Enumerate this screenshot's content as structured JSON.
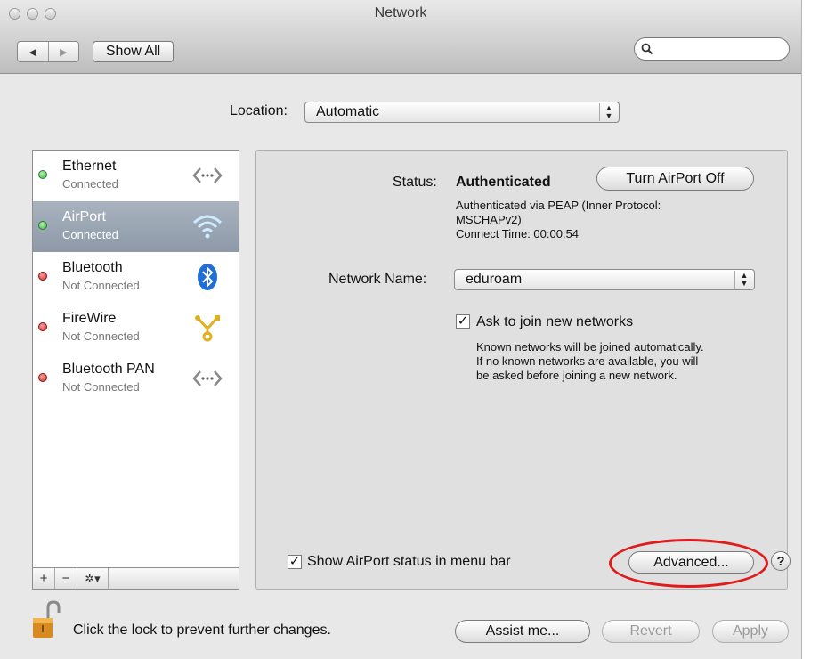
{
  "window": {
    "title": "Network"
  },
  "toolbar": {
    "back_glyph": "◀",
    "forward_glyph": "▶",
    "show_all_label": "Show All",
    "search_placeholder": ""
  },
  "location": {
    "label": "Location:",
    "value": "Automatic"
  },
  "services": [
    {
      "name": "Ethernet",
      "status": "Connected",
      "dot_color": "#3cb043",
      "icon": "ethernet-icon"
    },
    {
      "name": "AirPort",
      "status": "Connected",
      "dot_color": "#3cb043",
      "icon": "wifi-icon",
      "selected": true
    },
    {
      "name": "Bluetooth",
      "status": "Not Connected",
      "dot_color": "#d62b2b",
      "icon": "bluetooth-icon"
    },
    {
      "name": "FireWire",
      "status": "Not Connected",
      "dot_color": "#d62b2b",
      "icon": "firewire-icon"
    },
    {
      "name": "Bluetooth PAN",
      "status": "Not Connected",
      "dot_color": "#d62b2b",
      "icon": "ethernet-icon"
    }
  ],
  "sidebar_controls": {
    "add": "+",
    "remove": "−",
    "action": "✲▾"
  },
  "panel": {
    "status_label": "Status:",
    "status_value": "Authenticated",
    "turn_off_button": "Turn AirPort Off",
    "status_detail_1": "Authenticated via PEAP (Inner Protocol:",
    "status_detail_2": "MSCHAPv2)",
    "status_detail_3": "Connect Time: 00:00:54",
    "network_name_label": "Network Name:",
    "network_name_value": "eduroam",
    "ask_join_label": "Ask to join new networks",
    "ask_join_help_1": "Known networks will be joined automatically.",
    "ask_join_help_2": "If no known networks are available, you will",
    "ask_join_help_3": "be asked before joining a new network.",
    "show_status_label": "Show AirPort status in menu bar",
    "advanced_button": "Advanced...",
    "help_button": "?"
  },
  "footer": {
    "lock_text": "Click the lock to prevent further changes.",
    "assist_button": "Assist me...",
    "revert_button": "Revert",
    "apply_button": "Apply"
  },
  "annotation_color": "#e01b1b"
}
